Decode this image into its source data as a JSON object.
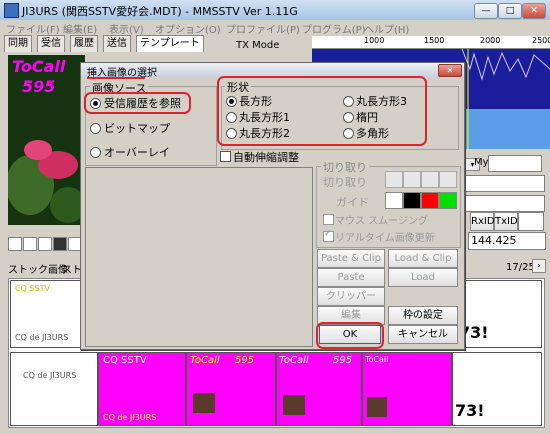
{
  "window": {
    "title": "JI3URS (関西SSTV愛好会.MDT) - MMSSTV Ver 1.11G",
    "min": "—",
    "max": "□",
    "close": "✕"
  },
  "menu": [
    "ファイル(F)",
    "編集(E)",
    "表示(V)",
    "オプション(O)",
    "プロファイル(P)",
    "プログラム(P)",
    "ヘルプ(H)"
  ],
  "tabs": [
    "同期",
    "受信",
    "履歴",
    "送信",
    "テンプレート"
  ],
  "tx_mode_label": "TX Mode",
  "ruler": [
    "1000",
    "1500",
    "2000",
    "2500"
  ],
  "preview": {
    "callsign": "ToCall",
    "number": "595"
  },
  "right_panel": {
    "my_label": "My",
    "rxid": "RxID",
    "txid": "TxID",
    "freq": "144.425",
    "page": "17/25"
  },
  "stock_tabs": [
    "ストック画像",
    "ストック"
  ],
  "stock_texts": {
    "cq_sstv": "CQ SSTV",
    "cq_de": "CQ   de   JI3URS",
    "tocall": "ToCall",
    "n595": "595",
    "num73": "73!"
  },
  "dialog": {
    "title": "挿入画像の選択",
    "source_group": "画像ソース",
    "sources": [
      "受信履歴を参照",
      "ビットマップ",
      "オーバーレイ"
    ],
    "selected_source": 0,
    "shape_group": "形状",
    "shapes": [
      "長方形",
      "丸長方形1",
      "丸長方形2",
      "丸長方形3",
      "楕円",
      "多角形"
    ],
    "selected_shape": 0,
    "auto_resize": "自動伸縮調整",
    "crop_group": "切り取り",
    "crop_label": "切り取り",
    "guide_label": "ガイド",
    "mouse_smoothing": "マウス スムージング",
    "realtime_update": "リアルタイム画像更新",
    "buttons": {
      "paste_clip": "Paste & Clip",
      "load_clip": "Load & Clip",
      "paste": "Paste",
      "load": "Load",
      "clipper": "クリッパー",
      "edit": "編集",
      "frame_settings": "枠の設定",
      "ok": "OK",
      "cancel": "キャンセル"
    }
  },
  "colors": {
    "highlight_ring": "#d9262c",
    "magenta": "#ff00ff",
    "accent_blue": "#0000cc"
  }
}
